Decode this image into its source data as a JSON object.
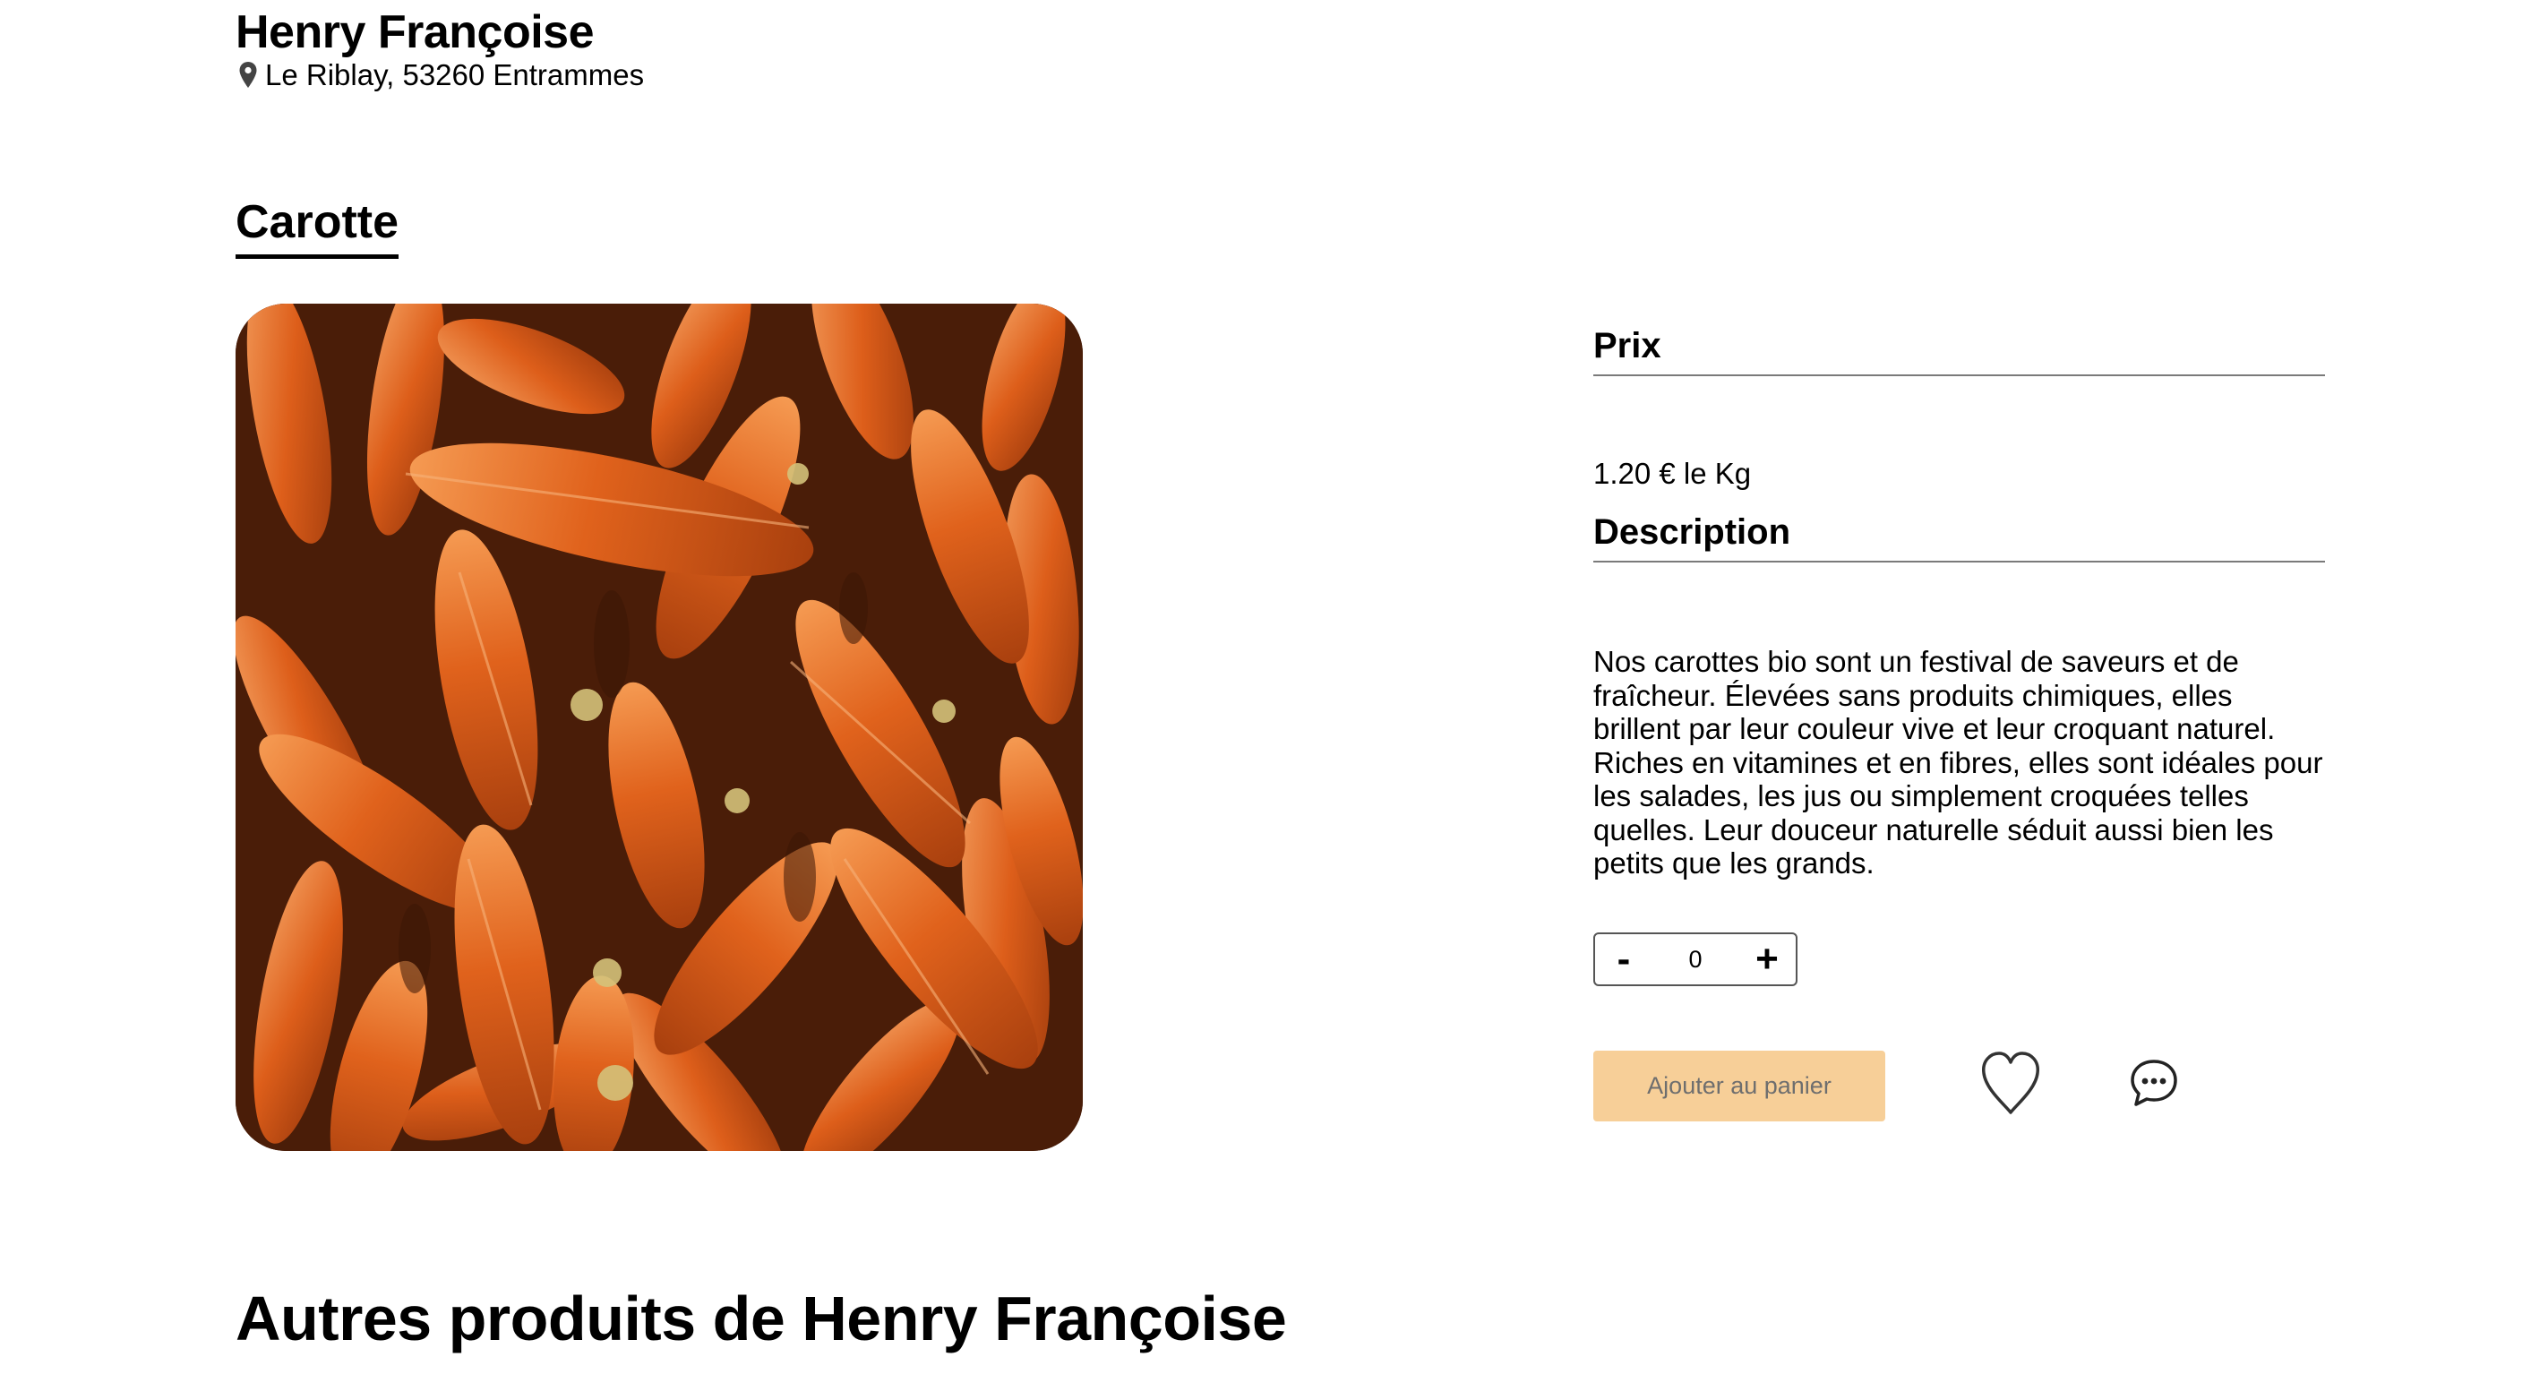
{
  "producer": {
    "name": "Henry Françoise",
    "address": "Le Riblay, 53260 Entrammes",
    "address_icon": "location-pin-icon"
  },
  "product": {
    "name": "Carotte",
    "image_alt": "carrots",
    "price_heading": "Prix",
    "price_value": "1.20 € le Kg",
    "description_heading": "Description",
    "description": "Nos carottes bio sont un festival de saveurs et de fraîcheur. Élevées sans produits chimiques, elles brillent par leur couleur vive et leur croquant naturel. Riches en vitamines et en fibres, elles sont idéales pour les salades, les jus ou simplement croquées telles quelles. Leur douceur naturelle séduit aussi bien les petits que les grands."
  },
  "quantity": {
    "decrement_label": "-",
    "value": "0",
    "increment_label": "+"
  },
  "actions": {
    "add_to_cart_label": "Ajouter au panier",
    "add_to_cart_color": "#f7cf98",
    "favorite_icon": "heart-icon",
    "message_icon": "chat-bubble-icon"
  },
  "other_products": {
    "heading": "Autres produits de Henry Françoise"
  }
}
